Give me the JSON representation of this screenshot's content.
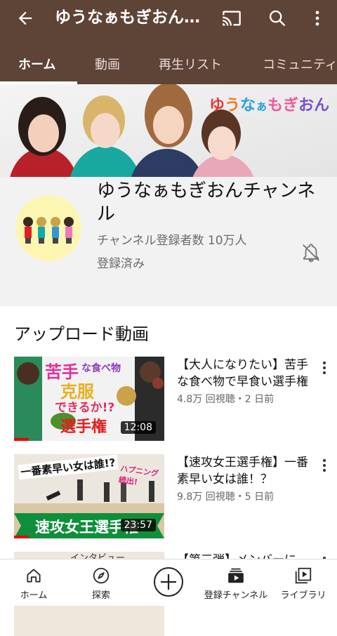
{
  "appbar": {
    "title": "ゆうなぁもぎおんチャンネル",
    "icons": [
      "back-arrow-icon",
      "cast-icon",
      "search-icon",
      "more-vert-icon"
    ]
  },
  "tabs": [
    {
      "label": "ホーム",
      "active": true
    },
    {
      "label": "動画",
      "active": false
    },
    {
      "label": "再生リスト",
      "active": false
    },
    {
      "label": "コミュニティ",
      "active": false
    }
  ],
  "banner": {
    "logo_text": [
      "ゆ",
      "う",
      "な",
      "ぁ",
      "も",
      "ぎ",
      "お",
      "ん"
    ],
    "logo_colors": [
      "#e8383d",
      "#f07a1a",
      "#2aa0e0",
      "#2aa0e0",
      "#ee5a9a",
      "#ee5a9a",
      "#7a4fd0",
      "#7a4fd0"
    ]
  },
  "channel": {
    "name": "ゆうなぁもぎおんチャンネル",
    "subscribers": "チャンネル登録者数 10万人",
    "status": "登録済み"
  },
  "section": {
    "title": "アップロード動画"
  },
  "videos": [
    {
      "title": "【大人になりたい】苦手な食べ物で早食い選手権",
      "meta": "4.8万 回視聴・2 日前",
      "duration": "12:08",
      "thumb_text": [
        "苦手",
        "な食べ物",
        "克服",
        "できるか!?",
        "選手権"
      ],
      "progress": 0.1
    },
    {
      "title": "【速攻女王選手権】一番素早い女は誰！？",
      "meta": "9.8万 回視聴・5 日前",
      "duration": "23:57",
      "thumb_text": [
        "一番素早い女は誰!?",
        "ハプニング続出!",
        "速攻女王選手権"
      ],
      "progress": 0.1
    },
    {
      "title": "【第三弾】メンバーに",
      "meta": "",
      "duration": "",
      "thumb_text": [
        "インタビュー"
      ],
      "progress": 0
    }
  ],
  "bottom_nav": [
    {
      "label": "ホーム",
      "icon": "home-icon"
    },
    {
      "label": "探索",
      "icon": "explore-compass-icon"
    },
    {
      "label": "",
      "icon": "create-plus-icon"
    },
    {
      "label": "登録チャンネル",
      "icon": "subscriptions-icon"
    },
    {
      "label": "ライブラリ",
      "icon": "library-icon"
    }
  ],
  "colors": {
    "appbar": "#5e4337",
    "accent": "#e00000"
  }
}
